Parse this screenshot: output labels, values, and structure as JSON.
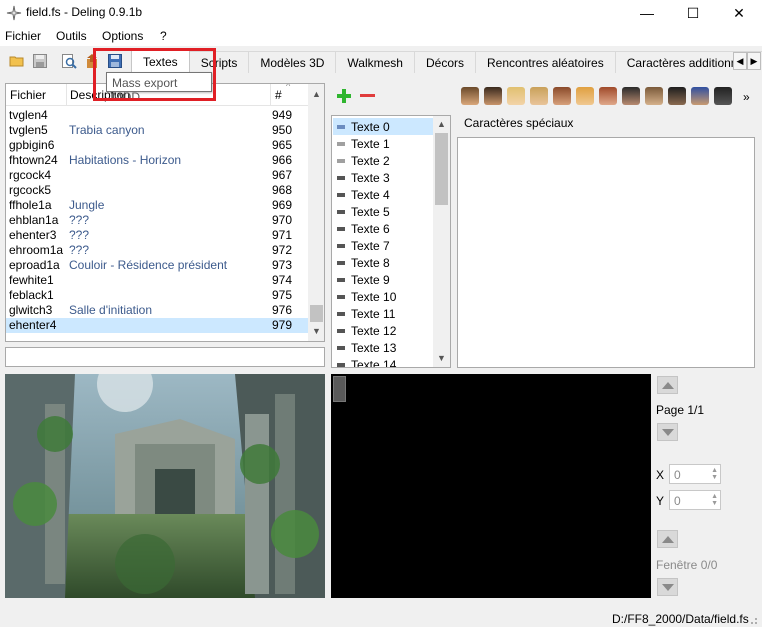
{
  "window": {
    "title": "field.fs - Deling 0.9.1b",
    "minimize": "—",
    "maximize": "☐",
    "close": "✕"
  },
  "menu": [
    "Fichier",
    "Outils",
    "Options",
    "?"
  ],
  "tabs": [
    "Textes",
    "Scripts",
    "Modèles 3D",
    "Walkmesh",
    "Décors",
    "Rencontres aléatoires",
    "Caractères additionnels"
  ],
  "tab_scroll": {
    "left": "◀",
    "right": "▶"
  },
  "tooltip": "Mass export MOD",
  "field_list": {
    "headers": {
      "file": "Fichier",
      "desc": "Description",
      "num": "#"
    },
    "rows": [
      {
        "file": "tvglen4",
        "desc": "",
        "num": "949"
      },
      {
        "file": "tvglen5",
        "desc": "Trabia canyon",
        "num": "950"
      },
      {
        "file": "gpbigin6",
        "desc": "",
        "num": "965"
      },
      {
        "file": "fhtown24",
        "desc": "Habitations - Horizon",
        "num": "966"
      },
      {
        "file": "rgcock4",
        "desc": "",
        "num": "967"
      },
      {
        "file": "rgcock5",
        "desc": "",
        "num": "968"
      },
      {
        "file": "ffhole1a",
        "desc": "Jungle",
        "num": "969"
      },
      {
        "file": "ehblan1a",
        "desc": "???",
        "num": "970"
      },
      {
        "file": "ehenter3",
        "desc": "???",
        "num": "971"
      },
      {
        "file": "ehroom1a",
        "desc": "???",
        "num": "972"
      },
      {
        "file": "eproad1a",
        "desc": "Couloir - Résidence président",
        "num": "973"
      },
      {
        "file": "fewhite1",
        "desc": "",
        "num": "974"
      },
      {
        "file": "feblack1",
        "desc": "",
        "num": "975"
      },
      {
        "file": "glwitch3",
        "desc": "Salle d'initiation",
        "num": "976"
      },
      {
        "file": "ehenter4",
        "desc": "",
        "num": "979"
      }
    ],
    "selected_index": 14
  },
  "text_list": {
    "items": [
      "Texte 0",
      "Texte 1",
      "Texte 2",
      "Texte 3",
      "Texte 4",
      "Texte 5",
      "Texte 6",
      "Texte 7",
      "Texte 8",
      "Texte 9",
      "Texte 10",
      "Texte 11",
      "Texte 12",
      "Texte 13",
      "Texte 14"
    ],
    "selected_index": 0
  },
  "chars_more": "»",
  "special_chars_label": "Caractères spéciaux",
  "controls": {
    "page_label": "Page 1/1",
    "x_label": "X",
    "x_value": "0",
    "y_label": "Y",
    "y_value": "0",
    "window_label": "Fenêtre 0/0"
  },
  "status": {
    "path": "D:/FF8_2000/Data/field.fs"
  },
  "colors": {
    "accent_selection": "#cce8ff",
    "highlight_box": "#e01f25",
    "desc_text": "#3c5a8c",
    "add_icon": "#2fb52f",
    "remove_icon": "#e03c3c"
  }
}
